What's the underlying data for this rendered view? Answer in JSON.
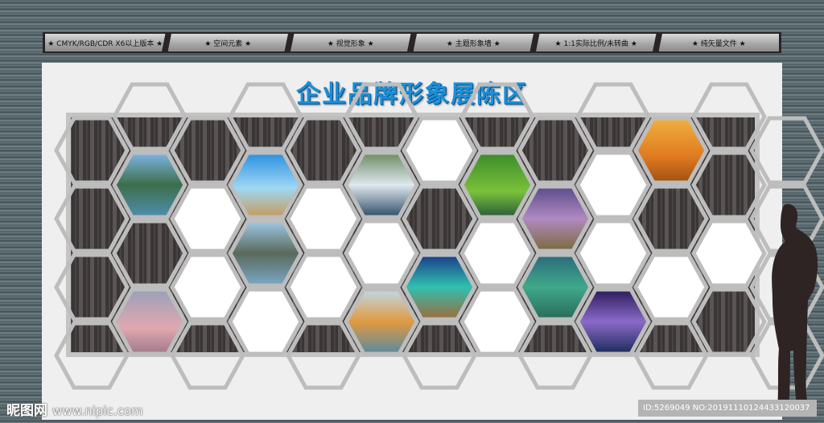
{
  "topbar": {
    "tabs": [
      "★ CMYK/RGB/CDR X6以上版本 ★",
      "★ 空间元素 ★",
      "★ 视觉形象 ★",
      "★ 主题形象墙 ★",
      "★ 1:1实际比例/未转曲 ★",
      "★ 纯矢量文件 ★"
    ]
  },
  "title": "企业品牌形象展陈区",
  "watermark": {
    "logo": "昵图网",
    "url": "www.nipic.com"
  },
  "id_text": "ID:5269049 NO:20191110124433120037",
  "colors": {
    "title": "#1a8fd8",
    "frame": "#bdbdbd",
    "wall": "#3d3838"
  }
}
